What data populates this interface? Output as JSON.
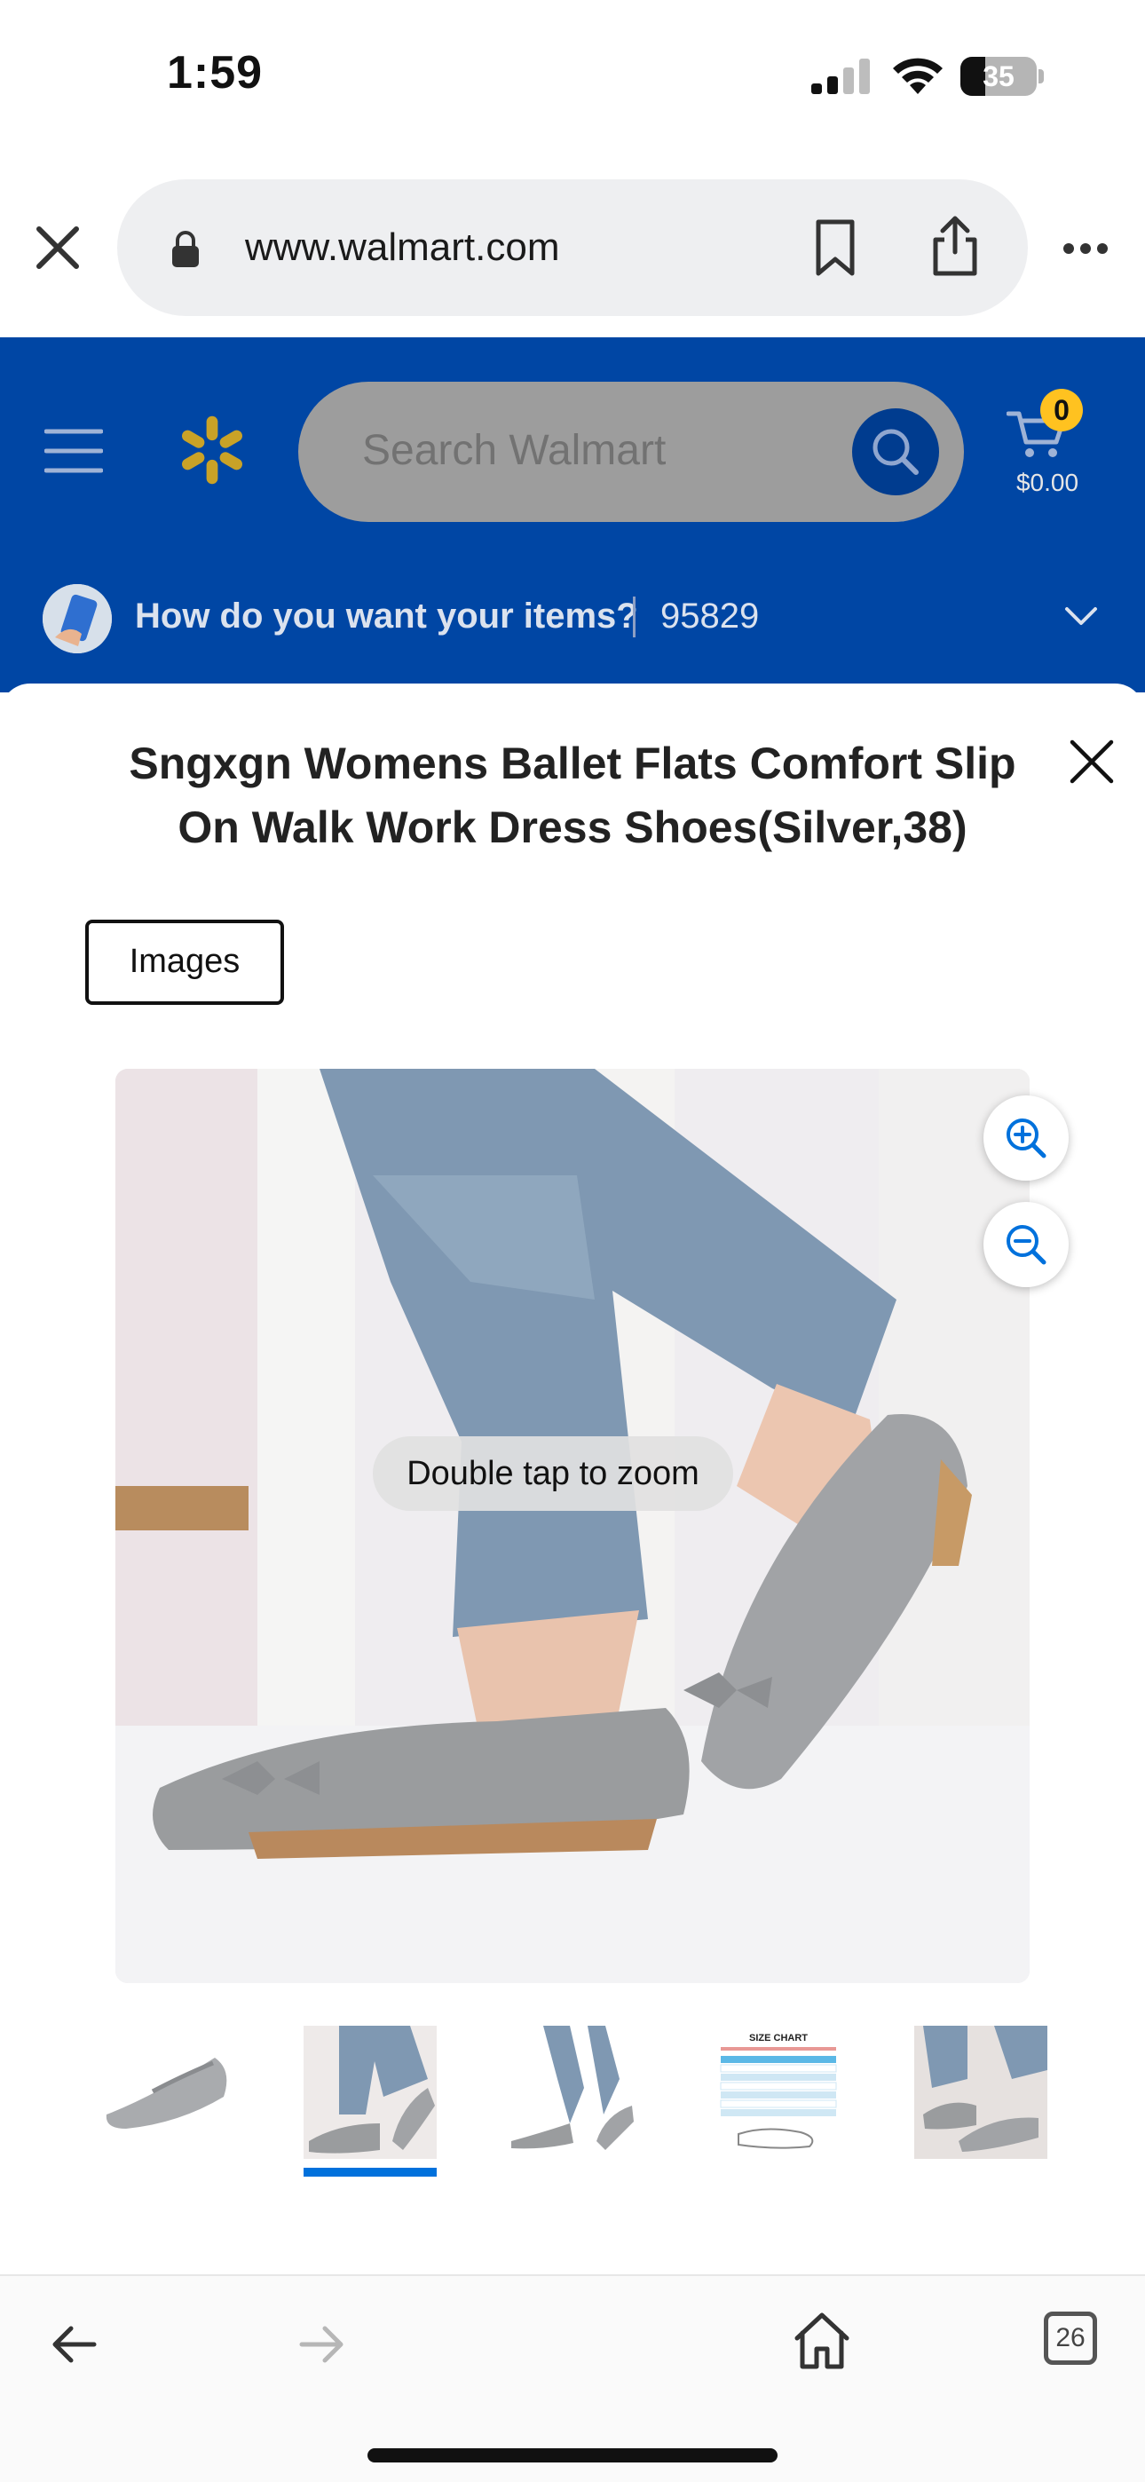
{
  "status_bar": {
    "time": "1:59",
    "battery_level": "35"
  },
  "browser": {
    "url": "www.walmart.com",
    "tab_count": "26"
  },
  "walmart_header": {
    "search_placeholder": "Search Walmart",
    "cart_count": "0",
    "cart_total": "$0.00",
    "delivery_prompt": "How do you want your items?",
    "zip_code": "95829",
    "brand_color": "#0046a4",
    "accent_color": "#ffc220"
  },
  "modal": {
    "title_line_1": "Sngxgn Womens Ballet Flats Comfort Slip",
    "title_line_2": "On Walk Work Dress Shoes(Silver,38)",
    "tab_label": "Images",
    "zoom_hint": "Double tap to zoom",
    "selected_thumbnail_index": 1
  },
  "size_chart_thumbnail": {
    "title": "SIZE CHART"
  }
}
